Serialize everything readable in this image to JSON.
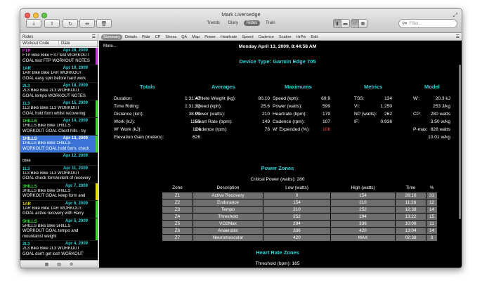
{
  "window": {
    "title": "Mark Liversedge"
  },
  "toolbar": {
    "views": [
      {
        "label": "Trends",
        "active": false
      },
      {
        "label": "Diary",
        "active": false
      },
      {
        "label": "Rides",
        "active": true
      },
      {
        "label": "Train",
        "active": false
      }
    ],
    "filter_placeholder": "Filter..."
  },
  "sidebar": {
    "title": "Rides",
    "col_code": "Workout Code",
    "col_date": "Date",
    "rides": [
      {
        "code": "FTP",
        "date": "Apr 28, 2009",
        "notes": "FTP Bike Bike FTP test WORKOUT GOAL test FTP WORKOUT NOTES",
        "code_color": "#e23be2",
        "bar_color": "#c23cd8",
        "selected": false
      },
      {
        "code": "1AR",
        "date": "Apr 19, 2009",
        "notes": "1AR Bike Bike 1AR WORKOUT GOAL easy spin before hard work",
        "code_color": "#2bd4d8",
        "bar_color": "",
        "selected": false
      },
      {
        "code": "2L3",
        "date": "Apr 18, 2009",
        "notes": "2L3 Bike Bike 2L3 WORKOUT GOAL tempo WORKOUT NOTES",
        "code_color": "#2bd4d8",
        "bar_color": "",
        "selected": false
      },
      {
        "code": "1L3",
        "date": "Apr 15, 2009",
        "notes": "1L3 Bike Bike 1L3 WORKOUT GOAL hold form whilst recovering",
        "code_color": "#2bd4d8",
        "bar_color": "#36d12e",
        "selected": false
      },
      {
        "code": "1HILLS",
        "date": "Apr 14, 2009",
        "notes": "1HILLS Bike Bike 1HILLS WORKOUT GOAL Client hills - try",
        "code_color": "#3ae03a",
        "bar_color": "#36d12e",
        "selected": false
      },
      {
        "code": "1HILLS",
        "date": "Apr 13, 2009",
        "notes": "1HILLS Bike Bike 1HILLS WORKOUT GOAL hold form, check",
        "code_color": "#ffffff",
        "bar_color": "#36d12e",
        "selected": true
      },
      {
        "code": "",
        "date": "Apr 12, 2009",
        "notes": "Bike",
        "code_color": "#2bd4d8",
        "bar_color": "",
        "selected": false
      },
      {
        "code": "1L3",
        "date": "Apr 11, 2009",
        "notes": "1L3 Bike Bike 1L3 WORKOUT GOAL check form/extent of recovery",
        "code_color": "#2bd4d8",
        "bar_color": "",
        "selected": false
      },
      {
        "code": "3HILLS",
        "date": "Apr 7, 2009",
        "notes": "3HILLS Bike Bike 3HILLS WORKOUT GOAL keep form and",
        "code_color": "#3ae03a",
        "bar_color": "#e8dc1a",
        "selected": false
      },
      {
        "code": "1AR",
        "date": "Apr 6, 2009",
        "notes": "1AR Bike Bike 1AR WORKOUT GOAL active recovery with Harry",
        "code_color": "#e8dc1a",
        "bar_color": "#36d12e",
        "selected": false
      },
      {
        "code": "5HILLS",
        "date": "Apr 5, 2009",
        "notes": "5HILLS Bike Bike 5HILLS WORKOUT GOAL tempo and mountains! weight",
        "code_color": "#3ae03a",
        "bar_color": "#36d12e",
        "selected": false
      },
      {
        "code": "2L3",
        "date": "Apr 4, 2009",
        "notes": "2L3 Bike Bike 2L3 WORKOUT GOAL don't get lost! WORKOUT",
        "code_color": "#2bd4d8",
        "bar_color": "",
        "selected": false
      }
    ]
  },
  "tabs": [
    {
      "label": "Summary",
      "active": true
    },
    {
      "label": "Details",
      "active": false
    },
    {
      "label": "Ride",
      "active": false
    },
    {
      "label": "CP",
      "active": false
    },
    {
      "label": "Stress",
      "active": false
    },
    {
      "label": "QA",
      "active": false
    },
    {
      "label": "Map",
      "active": false
    },
    {
      "label": "Power",
      "active": false
    },
    {
      "label": "Heartrate",
      "active": false
    },
    {
      "label": "Speed",
      "active": false
    },
    {
      "label": "Cadence",
      "active": false
    },
    {
      "label": "Scatter",
      "active": false
    },
    {
      "label": "HrPw",
      "active": false
    },
    {
      "label": "Edit",
      "active": false
    }
  ],
  "summary": {
    "more": "More...",
    "ride_title": "Monday April 13, 2009, 8:44:58 AM",
    "device": "Device Type: Garmin Edge 705",
    "totals": {
      "heading": "Totals",
      "rows": [
        {
          "label": "Duration:",
          "value": "1:31:47"
        },
        {
          "label": "Time Riding:",
          "value": "1:31:22"
        },
        {
          "label": "Distance (km):",
          "value": "38.90"
        },
        {
          "label": "Work (kJ):",
          "value": "1150"
        },
        {
          "label": "W' Work (kJ):",
          "value": "124"
        },
        {
          "label": "Elevation Gain (meters):",
          "value": "626"
        }
      ]
    },
    "averages": {
      "heading": "Averages",
      "rows": [
        {
          "label": "Athlete Weight (kg):",
          "value": "80.10"
        },
        {
          "label": "Speed (kph):",
          "value": "25.6"
        },
        {
          "label": "Power (watts):",
          "value": "210"
        },
        {
          "label": "Heart Rate (bpm):",
          "value": "149"
        },
        {
          "label": "Cadence (rpm):",
          "value": "76"
        }
      ]
    },
    "maximums": {
      "heading": "Maximums",
      "rows": [
        {
          "label": "Speed (kph):",
          "value": "69.9"
        },
        {
          "label": "Power (watts):",
          "value": "599"
        },
        {
          "label": "Heartrate (bpm):",
          "value": "179"
        },
        {
          "label": "Cadence (rpm):",
          "value": "107"
        },
        {
          "label": "W' Expended (%):",
          "value": "108",
          "red": true
        }
      ]
    },
    "metrics": {
      "heading": "Metrics",
      "rows": [
        {
          "label": "TSS:",
          "value": "134"
        },
        {
          "label": "VI:",
          "value": "1.250"
        },
        {
          "label": "NP (watts):",
          "value": "262"
        },
        {
          "label": "IF:",
          "value": "0.936"
        }
      ]
    },
    "model": {
      "heading": "Model",
      "rows": [
        {
          "label": "W':",
          "value": "20.3 kJ"
        },
        {
          "label": "",
          "value": "253 J/kg"
        },
        {
          "label": "CP:",
          "value": "280 watts"
        },
        {
          "label": "",
          "value": "3.50 w/kg"
        },
        {
          "label": "P-max:",
          "value": "828 watts"
        },
        {
          "label": "",
          "value": "10.01 w/kg"
        }
      ]
    },
    "power_zones": {
      "heading": "Power Zones",
      "cp_line": "Critical Power (watts): 280",
      "columns": [
        "Zone",
        "Description",
        "Low (watts)",
        "High (watts)",
        "Time",
        "%"
      ],
      "rows": [
        [
          "Z1",
          "Active Recovery",
          "0",
          "154",
          "28:16",
          "31"
        ],
        [
          "Z2",
          "Endurance",
          "154",
          "210",
          "11:26",
          "12"
        ],
        [
          "Z3",
          "Tempo",
          "210",
          "252",
          "12:38",
          "14"
        ],
        [
          "Z4",
          "Threshold",
          "252",
          "294",
          "13:22",
          "15"
        ],
        [
          "Z5",
          "VO2Max",
          "294",
          "336",
          "10:06",
          "11"
        ],
        [
          "Z6",
          "Anaerobic",
          "336",
          "420",
          "13:04",
          "14"
        ],
        [
          "Z7",
          "Neuromuscular",
          "420",
          "MAX",
          "02:38",
          "3"
        ]
      ]
    },
    "hr_zones": {
      "heading": "Heart Rate Zones",
      "threshold_line": "Threshold (bpm): 165"
    }
  },
  "colors": {
    "accent_cyan": "#2bd4d8",
    "alert_red": "#ff4b3a",
    "selection_blue": "#3b74d6"
  }
}
